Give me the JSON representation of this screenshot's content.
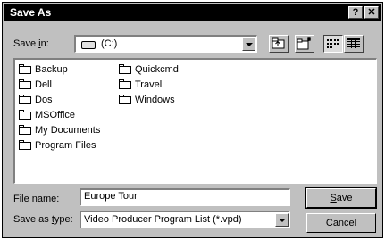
{
  "window": {
    "title": "Save As",
    "help_label": "?",
    "close_label": "✕"
  },
  "save_in": {
    "label_pre": "Save ",
    "label_key": "i",
    "label_post": "n:",
    "value": "(C:)",
    "drive_icon": "drive-icon"
  },
  "toolbar": {
    "up_icon": "up-folder-icon",
    "new_folder_icon": "new-folder-icon",
    "list_icon": "list-view-icon",
    "details_icon": "details-view-icon"
  },
  "folders": {
    "col1": [
      "Backup",
      "Dell",
      "Dos",
      "MSOffice",
      "My Documents",
      "Program Files"
    ],
    "col2": [
      "Quickcmd",
      "Travel",
      "Windows"
    ]
  },
  "file_name": {
    "label_pre": "File ",
    "label_key": "n",
    "label_post": "ame:",
    "value": "Europe Tour"
  },
  "save_type": {
    "label_pre": "Save as ",
    "label_key": "t",
    "label_post": "ype:",
    "value": "Video Producer Program List (*.vpd)"
  },
  "buttons": {
    "save_key": "S",
    "save_rest": "ave",
    "cancel": "Cancel"
  }
}
